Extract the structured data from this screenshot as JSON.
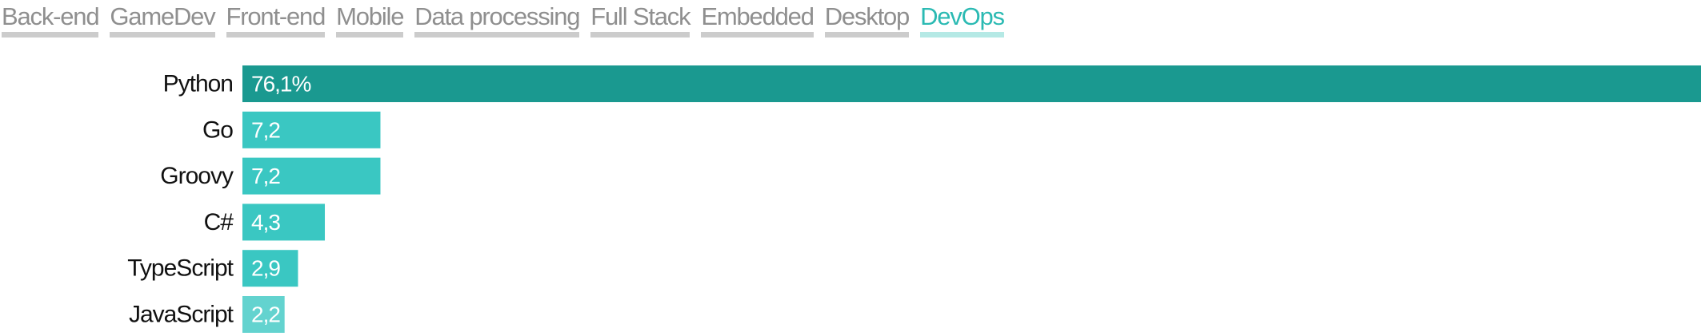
{
  "tabs": [
    {
      "label": "Back-end",
      "active": false
    },
    {
      "label": "GameDev",
      "active": false
    },
    {
      "label": "Front-end",
      "active": false
    },
    {
      "label": "Mobile",
      "active": false
    },
    {
      "label": "Data processing",
      "active": false
    },
    {
      "label": "Full Stack",
      "active": false
    },
    {
      "label": "Embedded",
      "active": false
    },
    {
      "label": "Desktop",
      "active": false
    },
    {
      "label": "DevOps",
      "active": true
    }
  ],
  "chart_data": {
    "type": "bar",
    "orientation": "horizontal",
    "categories": [
      "Python",
      "Go",
      "Groovy",
      "C#",
      "TypeScript",
      "JavaScript"
    ],
    "values": [
      76.1,
      7.2,
      7.2,
      4.3,
      2.9,
      2.2
    ],
    "value_labels": [
      "76,1%",
      "7,2",
      "7,2",
      "4,3",
      "2,9",
      "2,2"
    ],
    "bar_colors": [
      "#1a9990",
      "#3ac7c2",
      "#3ac7c2",
      "#3ac7c2",
      "#3ac7c2",
      "#63d3cf"
    ],
    "xlim": [
      0,
      76.1
    ],
    "title": "",
    "xlabel": "",
    "ylabel": "",
    "grid": false,
    "legend": "none"
  }
}
